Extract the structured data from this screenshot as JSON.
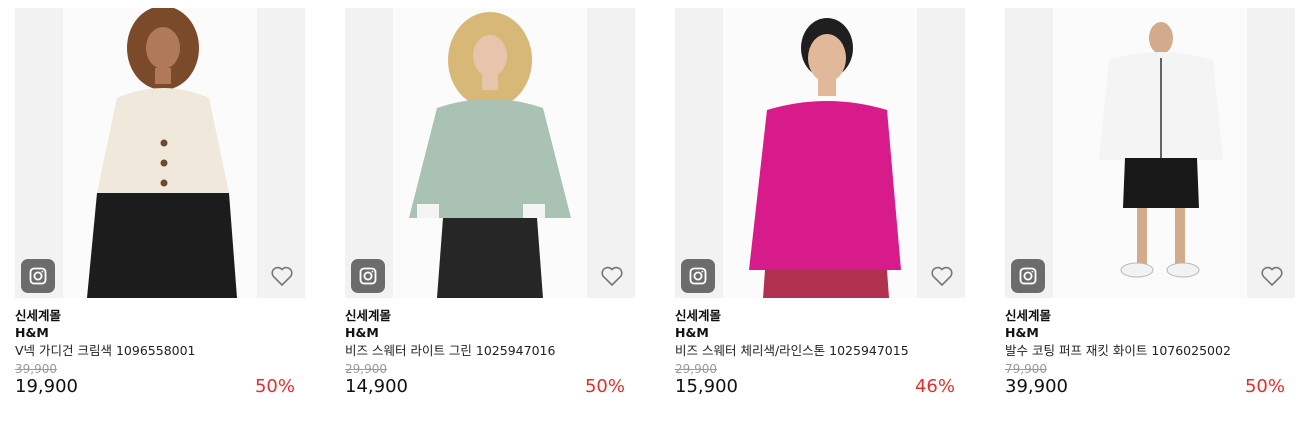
{
  "colors": {
    "discount": "#e52d2d",
    "original_price": "#9a9a9a",
    "image_bg": "#f2f2f2"
  },
  "products": [
    {
      "category": "신세계몰",
      "brand": "H&M",
      "title": "V넥 가디건 크림색 1096558001",
      "original_price": "39,900",
      "price": "19,900",
      "discount": "50%",
      "garment_color": "#efe8db",
      "bottom_color": "#1c1c1c"
    },
    {
      "category": "신세계몰",
      "brand": "H&M",
      "title": "비즈 스웨터 라이트 그린 1025947016",
      "original_price": "29,900",
      "price": "14,900",
      "discount": "50%",
      "garment_color": "#a9c2b3",
      "bottom_color": "#262626"
    },
    {
      "category": "신세계몰",
      "brand": "H&M",
      "title": "비즈 스웨터 체리색/라인스톤 1025947015",
      "original_price": "29,900",
      "price": "15,900",
      "discount": "46%",
      "garment_color": "#d81b8a",
      "bottom_color": "#b0304f"
    },
    {
      "category": "신세계몰",
      "brand": "H&M",
      "title": "발수 코팅 퍼프 재킷 화이트 1076025002",
      "original_price": "79,900",
      "price": "39,900",
      "discount": "50%",
      "garment_color": "#f4f4f4",
      "bottom_color": "#181818"
    }
  ]
}
